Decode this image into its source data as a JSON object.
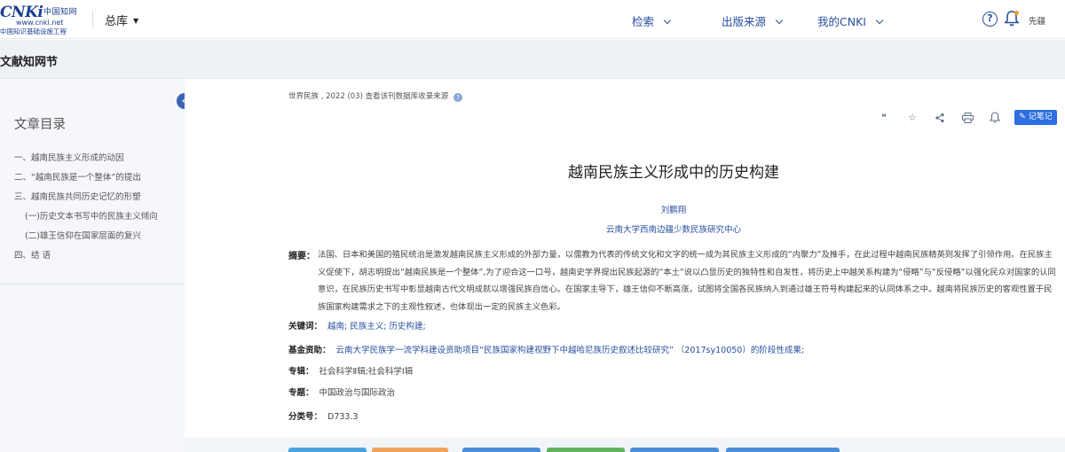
{
  "header": {
    "logo": {
      "mark": "CNKi",
      "cn": "中国知网",
      "url": "www.cnki.net",
      "sub": "中国知识基础设施工程"
    },
    "library": "总库",
    "nav": [
      "检索",
      "出版来源",
      "我的CNKI"
    ],
    "user_name": "先疆"
  },
  "section_title": "文献知网节",
  "sidebar": {
    "title": "文章目录",
    "items": [
      "一、越南民族主义形成的动因",
      "二、“越南民族是一个整体”的提出",
      "三、越南民族共同历史记忆的形塑",
      "(一)历史文本书写中的民族主义倾向",
      "(二)雄王信仰在国家层面的复兴",
      "四、结 语"
    ],
    "collapse_icon": "chevron-left-icon"
  },
  "article": {
    "source_line": "世界民族 , 2022 (03)   查看该刊数据库收录来源",
    "tools": [
      "quote-icon",
      "star-icon",
      "share-icon",
      "print-icon",
      "bell-icon"
    ],
    "note_button": "记笔记",
    "title": "越南民族主义形成中的历史构建",
    "author": "刘鹏翔",
    "affiliation": "云南大学西南边疆少数民族研究中心",
    "abstract_label": "摘要：",
    "abstract": "法国、日本和美国的殖民统治是激发越南民族主义形成的外部力量，以儒教为代表的传统文化和文字的统一成为其民族主义形成的“内聚力”及推手，在此过程中越南民族精英则发挥了引领作用。在民族主义促使下，胡志明提出“越南民族是一个整体”,为了迎合这一口号，越南史学界提出民族起源的“本土”说以凸显历史的独特性和自发性，将历史上中越关系构建为“侵略”与“反侵略”以强化民众对国家的认同意识，在民族历史书写中彰显越南古代文明成就以增强民族自信心。在国家主导下，雄王信仰不断高涨，试图将全国各民族纳入到通过雄王符号构建起来的认同体系之中。越南将民族历史的客观性置于民族国家构建需求之下的主观性叙述，也体现出一定的民族主义色彩。",
    "meta": [
      {
        "label": "关键词：",
        "value": "越南;  民族主义;  历史构建;"
      },
      {
        "label": "基金资助：",
        "value": "云南大学民族学一流学科建设资助项目“民族国家构建视野下中越哈尼族历史叙述比较研究” （2017sy10050）的阶段性成果;"
      },
      {
        "label": "专辑：",
        "value": "社会科学Ⅱ辑;社会科学Ⅰ辑"
      },
      {
        "label": "专题：",
        "value": "中国政治与国际政治"
      },
      {
        "label": "分类号：",
        "value": "D733.3"
      }
    ]
  },
  "colors": {
    "brand_blue": "#1b3f8f",
    "link_blue": "#2a4fa0",
    "accent_blue": "#2d6ee0",
    "button_colors": [
      "#4aa3df",
      "#f0a35a",
      "#4a8fd8",
      "#62b35c",
      "#4a8fd8",
      "#4a8fd8"
    ]
  }
}
